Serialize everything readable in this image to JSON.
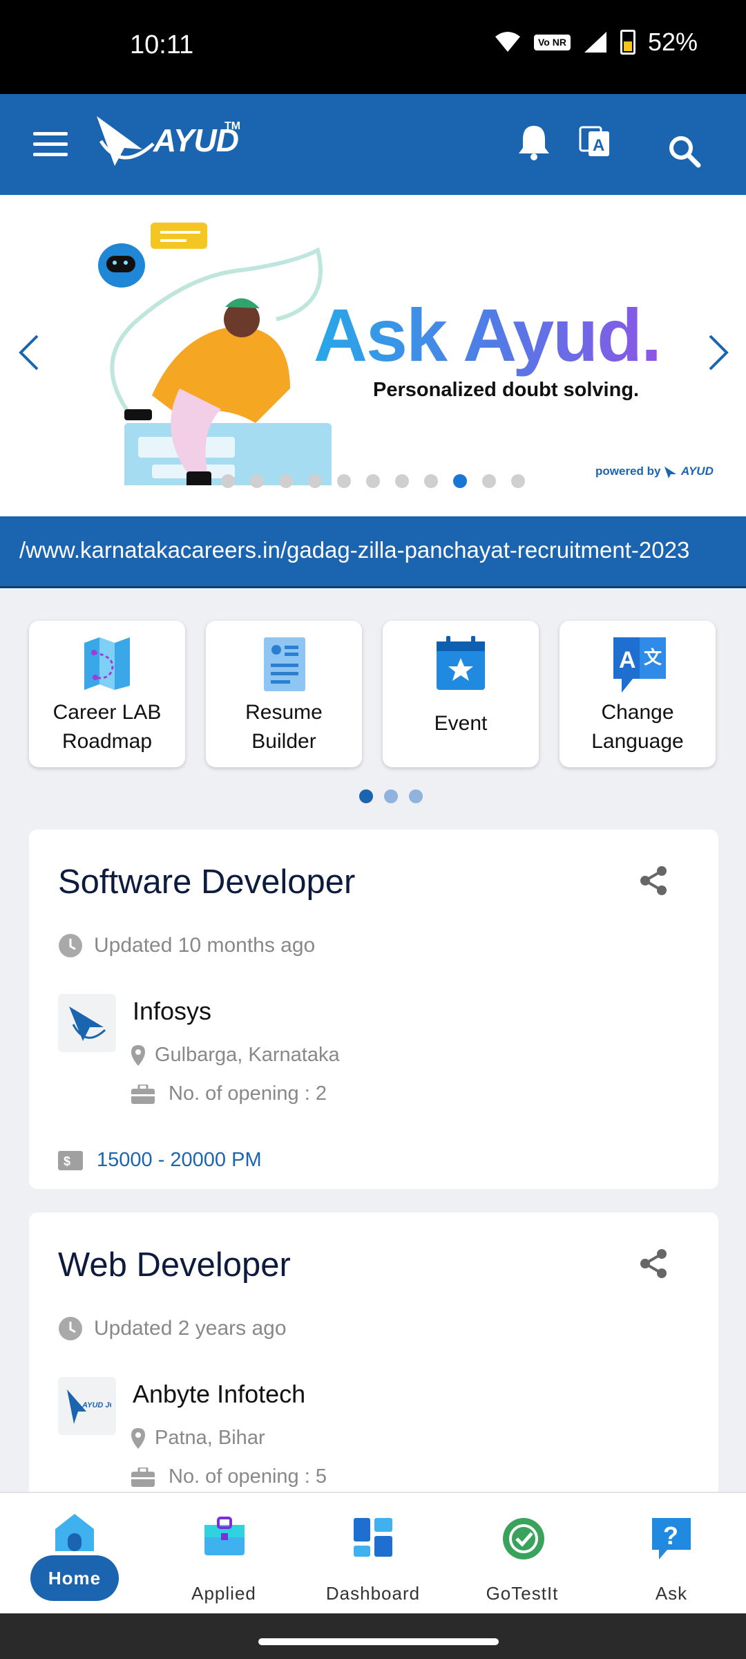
{
  "status_bar": {
    "time": "10:11",
    "battery": "52%",
    "network": "Vo NR"
  },
  "app_bar": {
    "logo_text": "AYUD",
    "logo_tm": "TM"
  },
  "banner": {
    "title": "Ask Ayud.",
    "subtitle": "Personalized doubt solving.",
    "powered_by": "powered by",
    "powered_brand": "AYUD",
    "slide_count": 11,
    "active_slide": 9
  },
  "marquee": {
    "text": "/www.karnatakacareers.in/gadag-zilla-panchayat-recruitment-2023"
  },
  "tiles": [
    {
      "line1": "Career LAB",
      "line2": "Roadmap"
    },
    {
      "line1": "Resume",
      "line2": "Builder"
    },
    {
      "line1": "Event",
      "line2": ""
    },
    {
      "line1": "Change",
      "line2": "Language"
    }
  ],
  "tile_pages": {
    "count": 3,
    "active": 1
  },
  "jobs": [
    {
      "title": "Software Developer",
      "updated": "Updated 10 months ago",
      "company": "Infosys",
      "location": "Gulbarga, Karnataka",
      "openings": "No. of opening : 2",
      "salary": "15000 - 20000 PM"
    },
    {
      "title": "Web Developer",
      "updated": "Updated 2 years ago",
      "company": "Anbyte Infotech",
      "location": "Patna, Bihar",
      "openings": "No. of opening : 5",
      "logo_text": "AYUD JOBS"
    }
  ],
  "bottom_nav": [
    {
      "label": "Home"
    },
    {
      "label": "Applied"
    },
    {
      "label": "Dashboard"
    },
    {
      "label": "GoTestIt"
    },
    {
      "label": "Ask"
    }
  ],
  "colors": {
    "primary": "#1b64b0",
    "active_dot": "#1976d2",
    "text_dark": "#0d1b3e",
    "muted": "#888888"
  }
}
